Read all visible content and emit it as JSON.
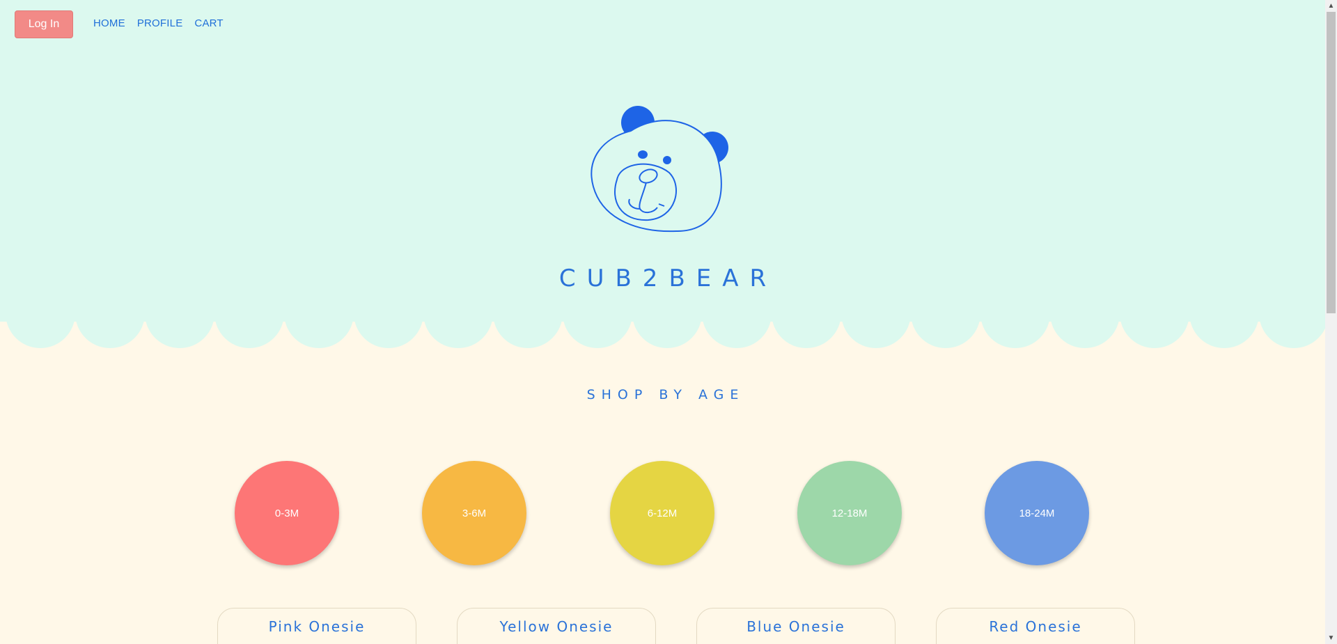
{
  "header": {
    "login_label": "Log In",
    "nav": [
      "HOME",
      "PROFILE",
      "CART"
    ],
    "brand": "CUB2BEAR",
    "logo_icon": "bear-face-icon"
  },
  "colors": {
    "hero_bg": "#dcf9ef",
    "page_bg": "#fff8e8",
    "accent": "#2a72d8",
    "login_bg": "#f28a87"
  },
  "shop_by_age": {
    "title": "SHOP BY AGE",
    "ages": [
      {
        "label": "0-3M",
        "color": "#fd7676"
      },
      {
        "label": "3-6M",
        "color": "#f7b843"
      },
      {
        "label": "6-12M",
        "color": "#e5d543"
      },
      {
        "label": "12-18M",
        "color": "#9dd7a9"
      },
      {
        "label": "18-24M",
        "color": "#6c9ae3"
      }
    ]
  },
  "products": [
    {
      "name": "Pink Onesie"
    },
    {
      "name": "Yellow Onesie"
    },
    {
      "name": "Blue Onesie"
    },
    {
      "name": "Red Onesie"
    }
  ]
}
